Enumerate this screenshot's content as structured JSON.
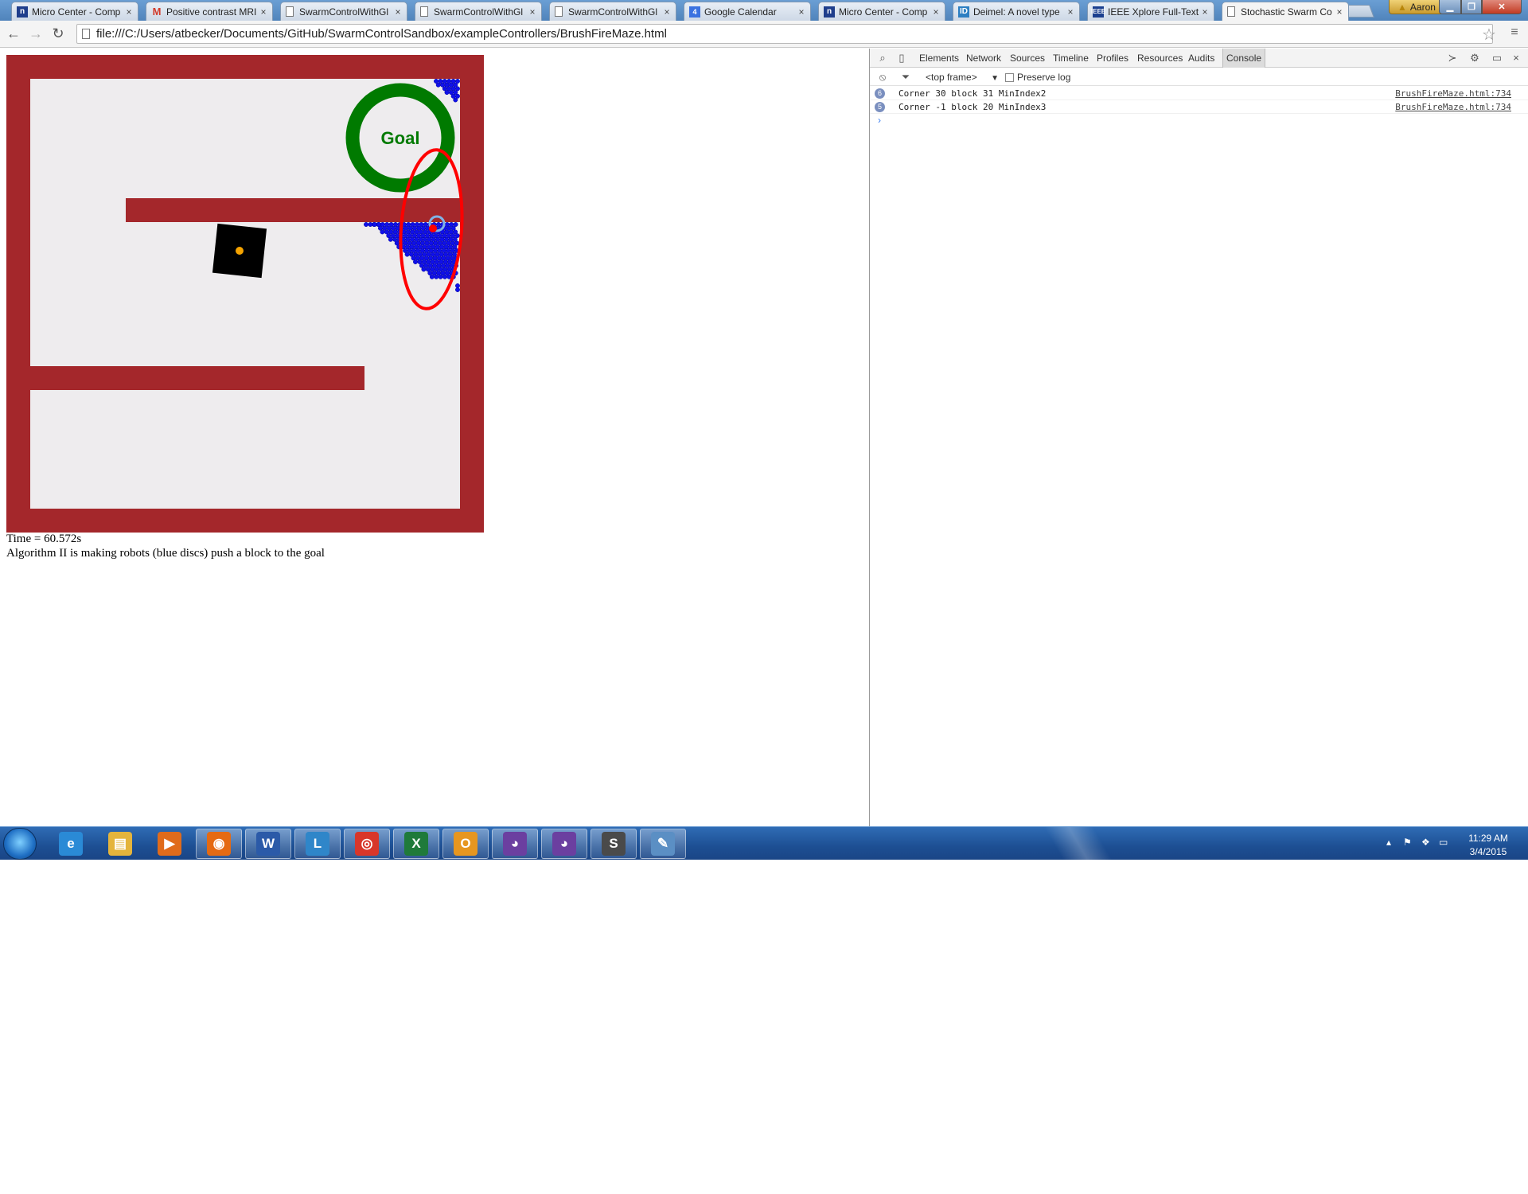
{
  "browser": {
    "tabs": [
      {
        "label": "Micro Center - Comp",
        "favicon": "microcenter-icon",
        "fav_text": "n",
        "active": false
      },
      {
        "label": "Positive contrast MRI",
        "favicon": "gmail-icon",
        "fav_text": "M",
        "active": false
      },
      {
        "label": "SwarmControlWithGl",
        "favicon": "page-icon",
        "fav_text": "",
        "active": false
      },
      {
        "label": "SwarmControlWithGl",
        "favicon": "page-icon",
        "fav_text": "",
        "active": false
      },
      {
        "label": "SwarmControlWithGl",
        "favicon": "page-icon",
        "fav_text": "",
        "active": false
      },
      {
        "label": "Google Calendar",
        "favicon": "calendar-icon",
        "fav_text": "4",
        "active": false
      },
      {
        "label": "Micro Center - Comp",
        "favicon": "microcenter-icon",
        "fav_text": "n",
        "active": false
      },
      {
        "label": "Deimel: A novel type",
        "favicon": "deimel-icon",
        "fav_text": "ID",
        "active": false
      },
      {
        "label": "IEEE Xplore Full-Text",
        "favicon": "ieee-icon",
        "fav_text": "IEEE",
        "active": false
      },
      {
        "label": "Stochastic Swarm Co",
        "favicon": "page-icon",
        "fav_text": "",
        "active": true
      }
    ],
    "tab_close_glyph": "×",
    "profile_name": "Aaron",
    "url": "file:///C:/Users/atbecker/Documents/GitHub/SwarmControlSandbox/exampleControllers/BrushFireMaze.html"
  },
  "simulation": {
    "goal_label": "Goal",
    "time_text": "Time = 60.572s",
    "algorithm_text": "Algorithm II is making robots (blue discs) push a block to the goal",
    "colors": {
      "wall": "#a4272b",
      "floor": "#eeecee",
      "goal_ring": "#007a00",
      "robot": "#1010e8",
      "block": "#000000",
      "block_center": "#f5a300",
      "highlight": "#ff0000",
      "target_ring": "#7fb2e5"
    }
  },
  "devtools": {
    "tabs": [
      "Elements",
      "Network",
      "Sources",
      "Timeline",
      "Profiles",
      "Resources",
      "Audits",
      "Console"
    ],
    "active_tab": "Console",
    "frame_selector": "<top frame>",
    "preserve_log_label": "Preserve log",
    "console_rows": [
      {
        "count": "6",
        "message": "Corner 30 block 31 MinIndex2",
        "source": "BrushFireMaze.html:734"
      },
      {
        "count": "5",
        "message": "Corner -1 block 20 MinIndex3",
        "source": "BrushFireMaze.html:734"
      }
    ],
    "prompt_glyph": "›"
  },
  "taskbar": {
    "apps": [
      {
        "name": "internet-explorer-icon",
        "glyph": "e",
        "color": "#2a8ad6"
      },
      {
        "name": "file-explorer-icon",
        "glyph": "▤",
        "color": "#e4b43c"
      },
      {
        "name": "media-player-icon",
        "glyph": "▶",
        "color": "#e06b1b"
      },
      {
        "name": "firefox-icon",
        "glyph": "◉",
        "color": "#e56a12"
      },
      {
        "name": "word-icon",
        "glyph": "W",
        "color": "#2b5aa8"
      },
      {
        "name": "lync-icon",
        "glyph": "L",
        "color": "#2f86c9"
      },
      {
        "name": "chrome-icon",
        "glyph": "◎",
        "color": "#d8362a"
      },
      {
        "name": "excel-icon",
        "glyph": "X",
        "color": "#1f7a3a"
      },
      {
        "name": "outlook-icon",
        "glyph": "O",
        "color": "#e69620"
      },
      {
        "name": "github-icon-1",
        "glyph": "◕",
        "color": "#6b3fa0"
      },
      {
        "name": "github-icon-2",
        "glyph": "◕",
        "color": "#6b3fa0"
      },
      {
        "name": "sublime-text-icon",
        "glyph": "S",
        "color": "#4a4a4a"
      },
      {
        "name": "paint-icon",
        "glyph": "✎",
        "color": "#5b8fc4"
      }
    ],
    "time": "11:29 AM",
    "date": "3/4/2015"
  }
}
